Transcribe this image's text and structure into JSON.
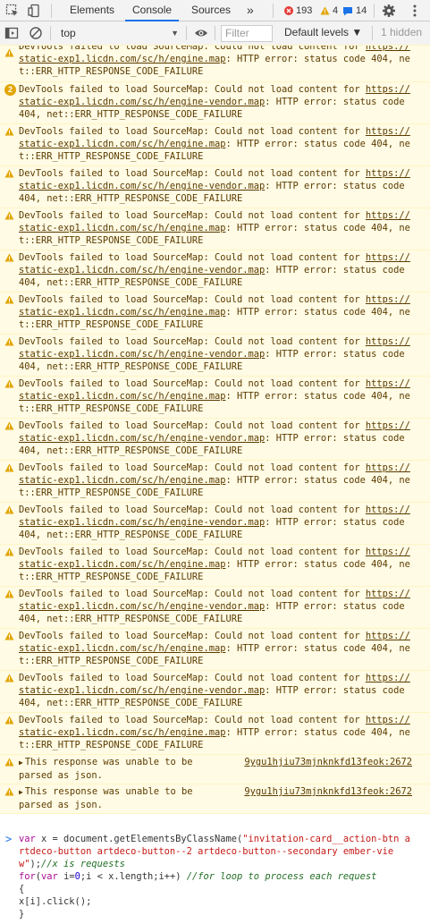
{
  "toolbar": {
    "tabs": [
      {
        "label": "Elements"
      },
      {
        "label": "Console"
      },
      {
        "label": "Sources"
      }
    ],
    "more_label": "»",
    "errors_count": "193",
    "warnings_count": "4",
    "info_count": "14",
    "colors": {
      "accent": "#1a73e8",
      "error": "#e53935",
      "warning": "#e2a500",
      "info": "#1a73e8"
    }
  },
  "console_toolbar": {
    "context": "top",
    "filter_placeholder": "Filter",
    "levels": "Default levels ▼",
    "hidden": "1 hidden"
  },
  "messages": [
    {
      "kind": "warn-partial",
      "pre": "DevTools failed to load SourceMap: Could not load content for ",
      "url": "https://static-exp1.licdn.com/sc/h/engine.map",
      "post": ": HTTP error: status code 404, net::ERR_HTTP_RESPONSE_CODE_FAILURE"
    },
    {
      "kind": "count",
      "count": "2",
      "pre": "DevTools failed to load SourceMap: Could not load content for ",
      "url": "https://static-exp1.licdn.com/sc/h/engine-vendor.map",
      "post": ": HTTP error: status code 404, net::ERR_HTTP_RESPONSE_CODE_FAILURE"
    },
    {
      "kind": "warn",
      "pre": "DevTools failed to load SourceMap: Could not load content for ",
      "url": "https://static-exp1.licdn.com/sc/h/engine.map",
      "post": ": HTTP error: status code 404, net::ERR_HTTP_RESPONSE_CODE_FAILURE"
    },
    {
      "kind": "warn",
      "pre": "DevTools failed to load SourceMap: Could not load content for ",
      "url": "https://static-exp1.licdn.com/sc/h/engine-vendor.map",
      "post": ": HTTP error: status code 404, net::ERR_HTTP_RESPONSE_CODE_FAILURE"
    },
    {
      "kind": "warn",
      "pre": "DevTools failed to load SourceMap: Could not load content for ",
      "url": "https://static-exp1.licdn.com/sc/h/engine.map",
      "post": ": HTTP error: status code 404, net::ERR_HTTP_RESPONSE_CODE_FAILURE"
    },
    {
      "kind": "warn",
      "pre": "DevTools failed to load SourceMap: Could not load content for ",
      "url": "https://static-exp1.licdn.com/sc/h/engine-vendor.map",
      "post": ": HTTP error: status code 404, net::ERR_HTTP_RESPONSE_CODE_FAILURE"
    },
    {
      "kind": "warn",
      "pre": "DevTools failed to load SourceMap: Could not load content for ",
      "url": "https://static-exp1.licdn.com/sc/h/engine.map",
      "post": ": HTTP error: status code 404, net::ERR_HTTP_RESPONSE_CODE_FAILURE"
    },
    {
      "kind": "warn",
      "pre": "DevTools failed to load SourceMap: Could not load content for ",
      "url": "https://static-exp1.licdn.com/sc/h/engine-vendor.map",
      "post": ": HTTP error: status code 404, net::ERR_HTTP_RESPONSE_CODE_FAILURE"
    },
    {
      "kind": "warn",
      "pre": "DevTools failed to load SourceMap: Could not load content for ",
      "url": "https://static-exp1.licdn.com/sc/h/engine.map",
      "post": ": HTTP error: status code 404, net::ERR_HTTP_RESPONSE_CODE_FAILURE"
    },
    {
      "kind": "warn",
      "pre": "DevTools failed to load SourceMap: Could not load content for ",
      "url": "https://static-exp1.licdn.com/sc/h/engine-vendor.map",
      "post": ": HTTP error: status code 404, net::ERR_HTTP_RESPONSE_CODE_FAILURE"
    },
    {
      "kind": "warn",
      "pre": "DevTools failed to load SourceMap: Could not load content for ",
      "url": "https://static-exp1.licdn.com/sc/h/engine.map",
      "post": ": HTTP error: status code 404, net::ERR_HTTP_RESPONSE_CODE_FAILURE"
    },
    {
      "kind": "warn",
      "pre": "DevTools failed to load SourceMap: Could not load content for ",
      "url": "https://static-exp1.licdn.com/sc/h/engine-vendor.map",
      "post": ": HTTP error: status code 404, net::ERR_HTTP_RESPONSE_CODE_FAILURE"
    },
    {
      "kind": "warn",
      "pre": "DevTools failed to load SourceMap: Could not load content for ",
      "url": "https://static-exp1.licdn.com/sc/h/engine.map",
      "post": ": HTTP error: status code 404, net::ERR_HTTP_RESPONSE_CODE_FAILURE"
    },
    {
      "kind": "warn",
      "pre": "DevTools failed to load SourceMap: Could not load content for ",
      "url": "https://static-exp1.licdn.com/sc/h/engine-vendor.map",
      "post": ": HTTP error: status code 404, net::ERR_HTTP_RESPONSE_CODE_FAILURE"
    },
    {
      "kind": "warn",
      "pre": "DevTools failed to load SourceMap: Could not load content for ",
      "url": "https://static-exp1.licdn.com/sc/h/engine.map",
      "post": ": HTTP error: status code 404, net::ERR_HTTP_RESPONSE_CODE_FAILURE"
    },
    {
      "kind": "warn",
      "pre": "DevTools failed to load SourceMap: Could not load content for ",
      "url": "https://static-exp1.licdn.com/sc/h/engine-vendor.map",
      "post": ": HTTP error: status code 404, net::ERR_HTTP_RESPONSE_CODE_FAILURE"
    },
    {
      "kind": "warn",
      "pre": "DevTools failed to load SourceMap: Could not load content for ",
      "url": "https://static-exp1.licdn.com/sc/h/engine.map",
      "post": ": HTTP error: status code 404, net::ERR_HTTP_RESPONSE_CODE_FAILURE"
    }
  ],
  "responses": [
    {
      "text": "This response was unable to be\nparsed as json.",
      "source": "9ygu1hjiu73mjnknkfd13feok:2672"
    },
    {
      "text": "This response was unable to be\nparsed as json.",
      "source": "9ygu1hjiu73mjnknkfd13feok:2672"
    }
  ],
  "input": {
    "prompt": ">"
  }
}
